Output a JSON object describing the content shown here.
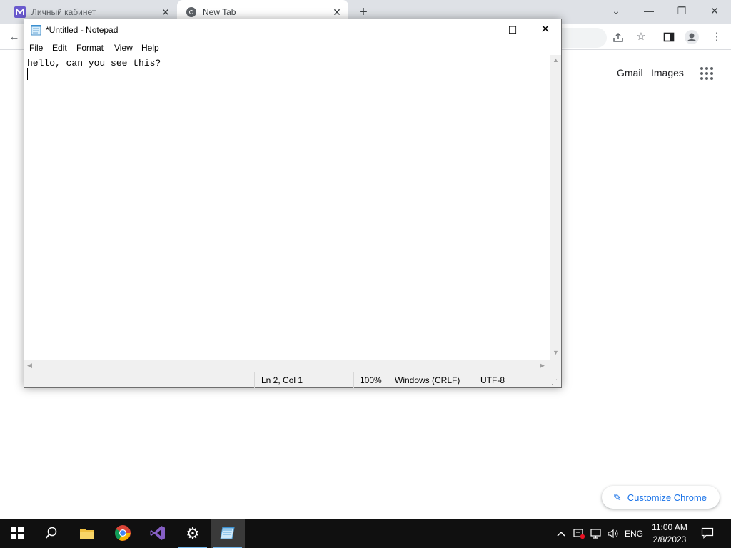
{
  "browser": {
    "tabs": [
      {
        "title": "Личный кабинет",
        "active": false
      },
      {
        "title": "New Tab",
        "active": true
      }
    ],
    "ntp": {
      "gmail": "Gmail",
      "images": "Images",
      "customize": "Customize Chrome"
    }
  },
  "notepad": {
    "title": "*Untitled - Notepad",
    "menu": [
      "File",
      "Edit",
      "Format",
      "View",
      "Help"
    ],
    "content": "hello, can you see this?",
    "status": {
      "position": "Ln 2, Col 1",
      "zoom": "100%",
      "line_ending": "Windows (CRLF)",
      "encoding": "UTF-8"
    }
  },
  "taskbar": {
    "pinned": [
      "start-icon",
      "search-icon",
      "file-explorer-icon",
      "chrome-icon",
      "visual-studio-icon",
      "settings-icon",
      "notepad-icon"
    ],
    "language": "ENG",
    "time": "11:00 AM",
    "date": "2/8/2023"
  },
  "colors": {
    "taskbar_bg": "#101010",
    "chrome_tabstrip": "#dee1e6",
    "accent_blue": "#1a73e8",
    "running_indicator": "#76b9ed"
  }
}
